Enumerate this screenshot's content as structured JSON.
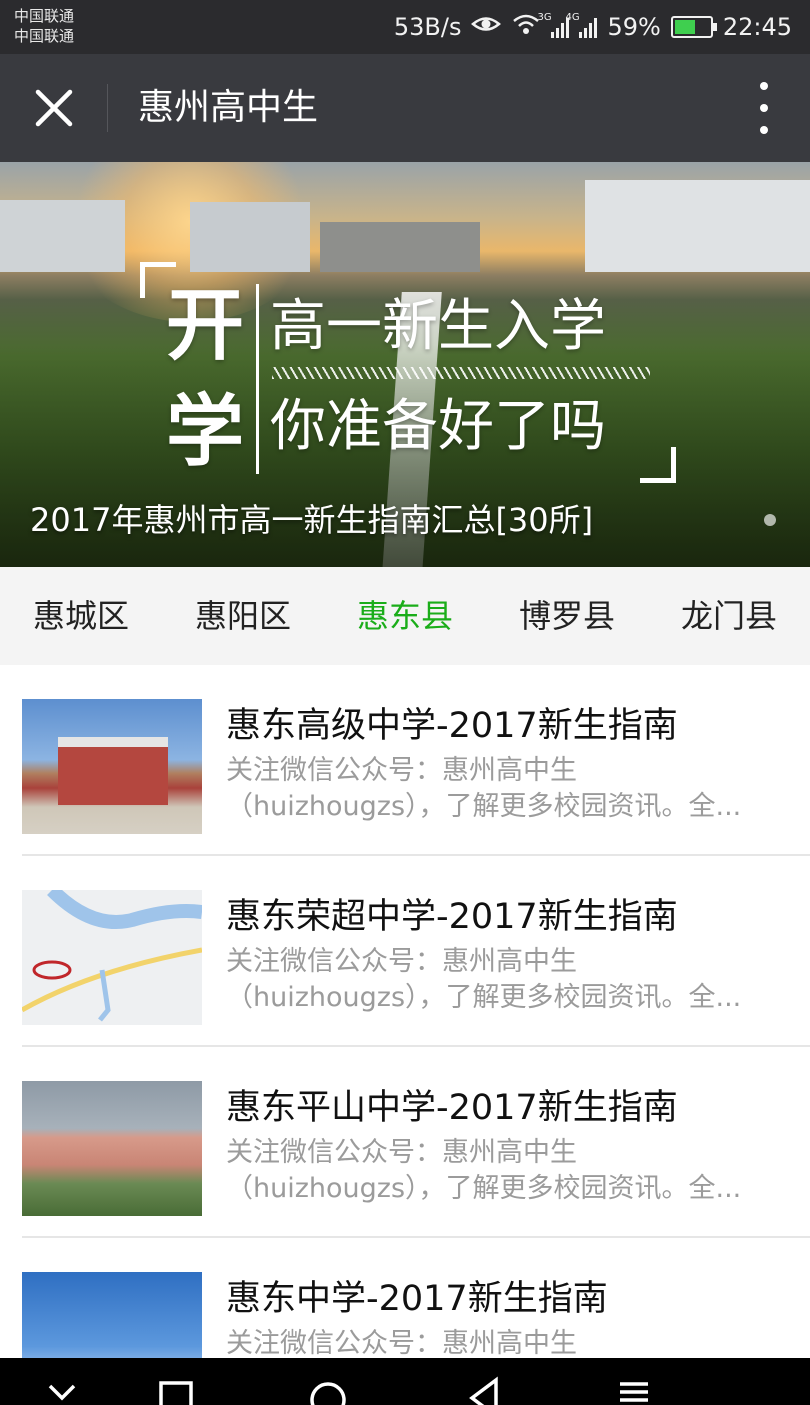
{
  "status_bar": {
    "carrier_1": "中国联通",
    "carrier_2": "中国联通",
    "speed": "53B/s",
    "network_3g": "3G",
    "network_4g": "4G",
    "battery_level": "59%",
    "battery_fraction": 0.59,
    "time": "22:45"
  },
  "header": {
    "title": "惠州高中生",
    "close_icon": "close-icon",
    "more_icon": "more-vertical-icon"
  },
  "banner": {
    "char_1": "开",
    "char_2": "学",
    "line_1": "高一新生入学",
    "line_2": "你准备好了吗",
    "caption": "2017年惠州市高一新生指南汇总[30所]"
  },
  "tabs": [
    {
      "label": "惠城区",
      "active": false
    },
    {
      "label": "惠阳区",
      "active": false
    },
    {
      "label": "惠东县",
      "active": true
    },
    {
      "label": "博罗县",
      "active": false
    },
    {
      "label": "龙门县",
      "active": false
    }
  ],
  "articles": [
    {
      "title": "惠东高级中学-2017新生指南",
      "desc_1": "关注微信公众号：惠州高中生",
      "desc_2": "（huizhougzs），了解更多校园资讯。全..."
    },
    {
      "title": "惠东荣超中学-2017新生指南",
      "desc_1": "关注微信公众号：惠州高中生",
      "desc_2": "（huizhougzs），了解更多校园资讯。全..."
    },
    {
      "title": "惠东平山中学-2017新生指南",
      "desc_1": "关注微信公众号：惠州高中生",
      "desc_2": "（huizhougzs），了解更多校园资讯。全..."
    },
    {
      "title": "惠东中学-2017新生指南",
      "desc_1": "关注微信公众号：惠州高中生",
      "desc_2": ""
    }
  ],
  "colors": {
    "title_bar": "#393a3f",
    "active_tab": "#1aad19",
    "battery_fill": "#3fcf4f"
  },
  "nav_bar": {
    "icons": [
      "hide-icon",
      "recents-square-icon",
      "home-circle-icon",
      "back-triangle-icon",
      "menu-icon"
    ]
  }
}
